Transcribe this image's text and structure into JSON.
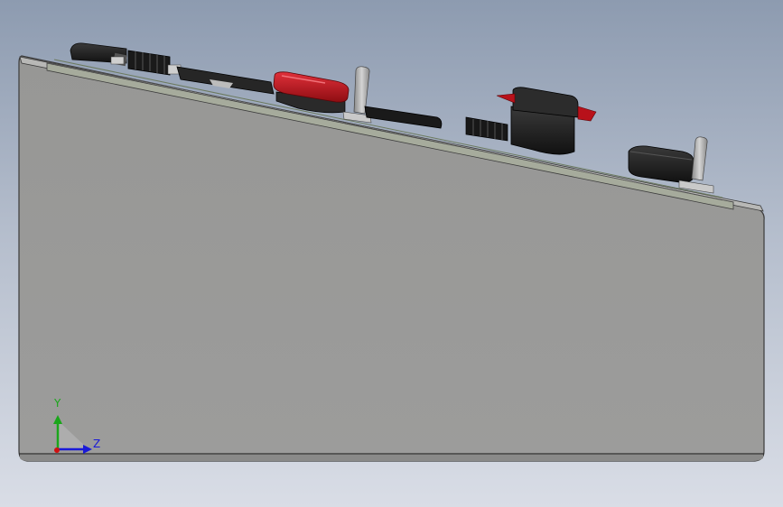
{
  "viewport": {
    "background_top": "#8d9bb0",
    "background_bottom": "#d9dde6"
  },
  "model": {
    "housing_color": "#9a9a99",
    "housing_edge_color": "#3a3a3a",
    "panel_color": "#a6ab9c",
    "knob_red_color": "#c0141c",
    "switch_black_color": "#1e1e1e",
    "toggle_lever_color": "#a7a7a7"
  },
  "triad": {
    "y_label": "Y",
    "z_label": "Z",
    "y_color": "#1aa61a",
    "z_color": "#1a1ad8",
    "x_color": "#d01010"
  }
}
